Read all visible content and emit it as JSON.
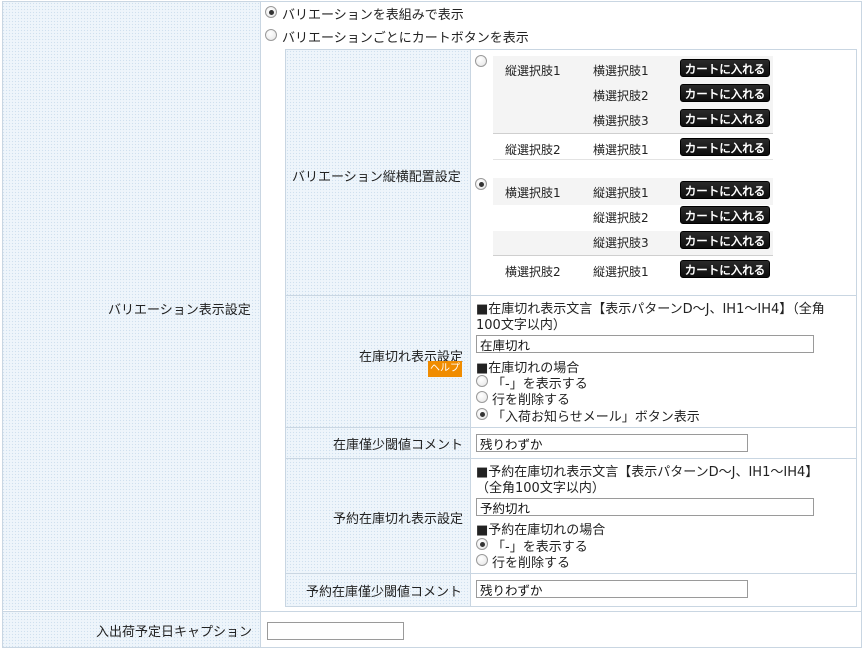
{
  "top_options": [
    {
      "label": "バリエーションを表組みで表示",
      "selected": true
    },
    {
      "label": "バリエーションごとにカートボタンを表示",
      "selected": false
    }
  ],
  "labels": {
    "variation_display": "バリエーション表示設定",
    "layout": "バリエーション縦横配置設定",
    "out_of_stock": "在庫切れ表示設定",
    "low_stock_comment": "在庫僅少閾値コメント",
    "reserve_out_of_stock": "予約在庫切れ表示設定",
    "reserve_low_stock_comment": "予約在庫僅少閾値コメント",
    "arrival_caption": "入出荷予定日キャプション",
    "help": "ヘルプ"
  },
  "layout_option_a": {
    "selected": false,
    "rows": [
      {
        "col1": "縦選択肢1",
        "col2": "横選択肢1",
        "button": "カートに入れる"
      },
      {
        "col1": "",
        "col2": "横選択肢2",
        "button": "カートに入れる"
      },
      {
        "col1": "",
        "col2": "横選択肢3",
        "button": "カートに入れる"
      },
      {
        "col1": "縦選択肢2",
        "col2": "横選択肢1",
        "button": "カートに入れる"
      }
    ]
  },
  "layout_option_b": {
    "selected": true,
    "rows": [
      {
        "col1": "横選択肢1",
        "col2": "縦選択肢1",
        "button": "カートに入れる"
      },
      {
        "col1": "",
        "col2": "縦選択肢2",
        "button": "カートに入れる"
      },
      {
        "col1": "",
        "col2": "縦選択肢3",
        "button": "カートに入れる"
      },
      {
        "col1": "横選択肢2",
        "col2": "縦選択肢1",
        "button": "カートに入れる"
      }
    ]
  },
  "out_of_stock": {
    "text_heading_line1": "■在庫切れ表示文言【表示パターンD～J、IH1～IH4】（全角",
    "text_heading_line2": "100文字以内）",
    "text_value": "在庫切れ",
    "case_heading": "■在庫切れの場合",
    "options": [
      {
        "label": "「-」を表示する",
        "selected": false
      },
      {
        "label": "行を削除する",
        "selected": false
      },
      {
        "label": "「入荷お知らせメール」ボタン表示",
        "selected": true
      }
    ]
  },
  "low_stock_comment_value": "残りわずか",
  "reserve_out_of_stock": {
    "text_heading_line1": "■予約在庫切れ表示文言【表示パターンD～J、IH1～IH4】",
    "text_heading_line2": "（全角100文字以内）",
    "text_value": "予約切れ",
    "case_heading": "■予約在庫切れの場合",
    "options": [
      {
        "label": "「-」を表示する",
        "selected": true
      },
      {
        "label": "行を削除する",
        "selected": false
      }
    ]
  },
  "reserve_low_stock_comment_value": "残りわずか",
  "arrival_caption_value": ""
}
